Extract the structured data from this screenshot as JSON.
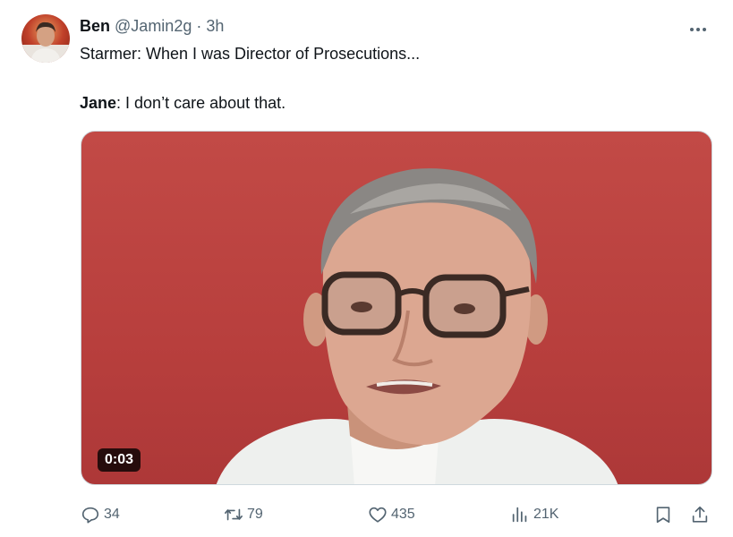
{
  "tweet": {
    "author_name": "Ben",
    "author_handle": "@Jamin2g",
    "separator": "·",
    "time": "3h",
    "line1": "Starmer: When I was Director of Prosecutions...",
    "line2_speaker": "Jane",
    "line2_text": ": I don’t care about that.",
    "video_duration": "0:03"
  },
  "actions": {
    "reply_count": "34",
    "retweet_count": "79",
    "like_count": "435",
    "view_count": "21K"
  },
  "icons": {
    "more": "more-horizontal-icon",
    "reply": "reply-icon",
    "retweet": "retweet-icon",
    "like": "heart-icon",
    "views": "views-chart-icon",
    "bookmark": "bookmark-icon",
    "share": "share-icon"
  },
  "colors": {
    "text": "#0f1419",
    "muted": "#536471",
    "video_background": "#b83f3d"
  }
}
